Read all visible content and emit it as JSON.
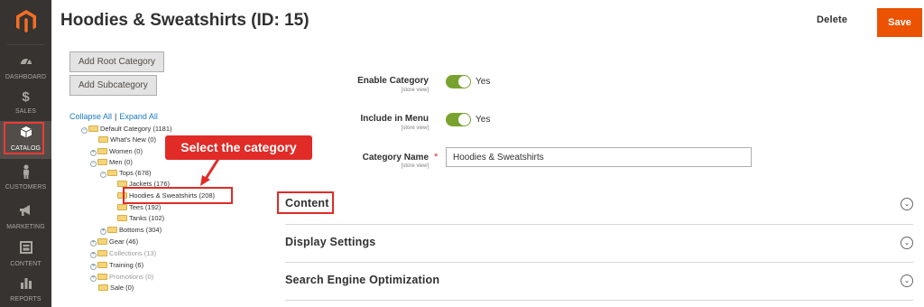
{
  "header": {
    "page_title": "Hoodies & Sweatshirts (ID: 15)",
    "delete_label": "Delete",
    "save_label": "Save"
  },
  "sidebar": {
    "items": [
      {
        "label": "DASHBOARD",
        "icon": "dashboard-icon"
      },
      {
        "label": "SALES",
        "icon": "dollar-icon"
      },
      {
        "label": "CATALOG",
        "icon": "box-icon",
        "active": true
      },
      {
        "label": "CUSTOMERS",
        "icon": "person-icon"
      },
      {
        "label": "MARKETING",
        "icon": "megaphone-icon"
      },
      {
        "label": "CONTENT",
        "icon": "layout-icon"
      },
      {
        "label": "REPORTS",
        "icon": "bar-chart-icon"
      }
    ]
  },
  "tree_panel": {
    "add_root_label": "Add Root Category",
    "add_sub_label": "Add Subcategory",
    "collapse_all": "Collapse All",
    "separator": "|",
    "expand_all": "Expand All",
    "nodes": [
      "Default Category (1181)",
      "What's New (0)",
      "Women (0)",
      "Men (0)",
      "Tops (678)",
      "Jackets (176)",
      "Hoodies & Sweatshirts (208)",
      "Tees (192)",
      "Tanks (102)",
      "Bottoms (304)",
      "Gear (46)",
      "Collections (13)",
      "Training (6)",
      "Promotions (0)",
      "Sale (0)"
    ],
    "annotation": "Select the category"
  },
  "form": {
    "enable_category": {
      "label": "Enable Category",
      "scope": "[store view]",
      "value": "Yes"
    },
    "include_in_menu": {
      "label": "Include in Menu",
      "scope": "[store view]",
      "value": "Yes"
    },
    "category_name": {
      "label": "Category Name",
      "required_mark": "*",
      "scope": "[store view]",
      "value": "Hoodies & Sweatshirts"
    }
  },
  "sections": [
    "Content",
    "Display Settings",
    "Search Engine Optimization"
  ],
  "colors": {
    "sidebar_bg": "#373330",
    "save_orange": "#eb5202",
    "toggle_green": "#79a22e",
    "annotation_red": "#e02b27",
    "link_blue": "#1979c3"
  }
}
